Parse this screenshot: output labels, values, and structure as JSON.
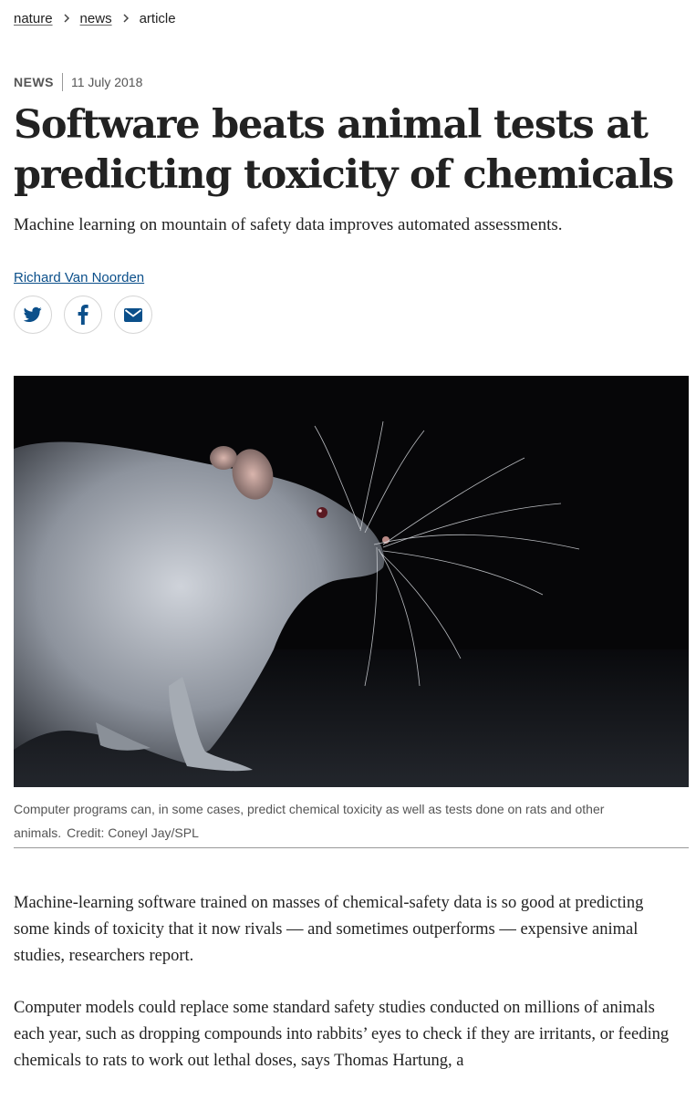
{
  "breadcrumb": {
    "items": [
      "nature",
      "news"
    ],
    "current": "article"
  },
  "article": {
    "type": "NEWS",
    "date": "11 July 2018",
    "title": "Software beats animal tests at predicting toxicity of chemicals",
    "standfirst": "Machine learning on mountain of safety data improves automated assessments.",
    "author": "Richard Van Noorden"
  },
  "share": {
    "icons": [
      "twitter-icon",
      "facebook-icon",
      "email-icon"
    ],
    "icon_color": "#0b4f8a"
  },
  "figure": {
    "caption": "Computer programs can, in some cases, predict chemical toxicity as well as tests done on rats and other animals.",
    "credit": "Credit: Coneyl Jay/SPL"
  },
  "body": {
    "paragraphs": [
      "Machine-learning software trained on masses of chemical-safety data is so good at predicting some kinds of toxicity that it now rivals — and sometimes outperforms — expensive animal studies, researchers report.",
      "Computer models could replace some standard safety studies conducted on millions of animals each year, such as dropping compounds into rabbits’ eyes to check if they are irritants, or feeding chemicals to rats to work out lethal doses, says Thomas Hartung, a"
    ]
  }
}
